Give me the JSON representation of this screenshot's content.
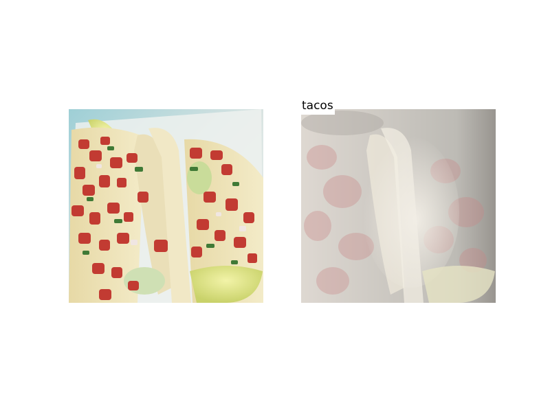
{
  "figure": {
    "label": "tacos",
    "panels": [
      {
        "content": "photo-tacos-with-pico-de-gallo-and-lime"
      },
      {
        "content": "faded-attention-overlay-of-tacos-photo"
      }
    ]
  }
}
